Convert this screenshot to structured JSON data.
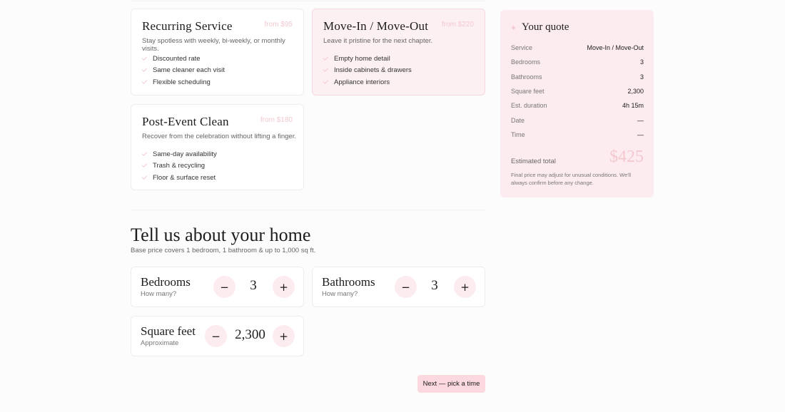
{
  "services": [
    {
      "title": "Recurring Service",
      "price": "from $95",
      "description": "Stay spotless with weekly, bi-weekly, or monthly visits.",
      "features": [
        "Discounted rate",
        "Same cleaner each visit",
        "Flexible scheduling"
      ]
    },
    {
      "title": "Move-In / Move-Out",
      "price": "from $220",
      "description": "Leave it pristine for the next chapter.",
      "features": [
        "Empty home detail",
        "Inside cabinets & drawers",
        "Appliance interiors"
      ]
    },
    {
      "title": "Post-Event Clean",
      "price": "from $180",
      "description": "Recover from the celebration without lifting a finger.",
      "features": [
        "Same-day availability",
        "Trash & recycling",
        "Floor & surface reset"
      ]
    }
  ],
  "quote": {
    "title": "Your quote",
    "rows": [
      {
        "label": "Service",
        "value": "Move-In / Move-Out"
      },
      {
        "label": "Bedrooms",
        "value": "3"
      },
      {
        "label": "Bathrooms",
        "value": "3"
      },
      {
        "label": "Square feet",
        "value": "2,300"
      },
      {
        "label": "Est. duration",
        "value": "4h 15m"
      },
      {
        "label": "Date",
        "value": "—"
      },
      {
        "label": "Time",
        "value": "—"
      }
    ],
    "estimated_label": "Estimated total",
    "total": "$425",
    "note": "Final price may adjust for unusual conditions. We'll always confirm before any change."
  },
  "home": {
    "heading": "Tell us about your home",
    "subheading": "Base price covers 1 bedroom, 1 bathroom & up to 1,000 sq ft.",
    "steppers": [
      {
        "title": "Bedrooms",
        "subtitle": "How many?",
        "value": "3"
      },
      {
        "title": "Bathrooms",
        "subtitle": "How many?",
        "value": "3"
      },
      {
        "title": "Square feet",
        "subtitle": "Approximate",
        "value": "2,300"
      }
    ],
    "minus": "−",
    "plus": "+"
  },
  "next_label": "Next — pick a time",
  "colors": {
    "accent": "#fbd9de",
    "selected_bg": "#fdf0f2",
    "quote_bg": "#fdecef",
    "price_pink": "#f3c9cf"
  }
}
